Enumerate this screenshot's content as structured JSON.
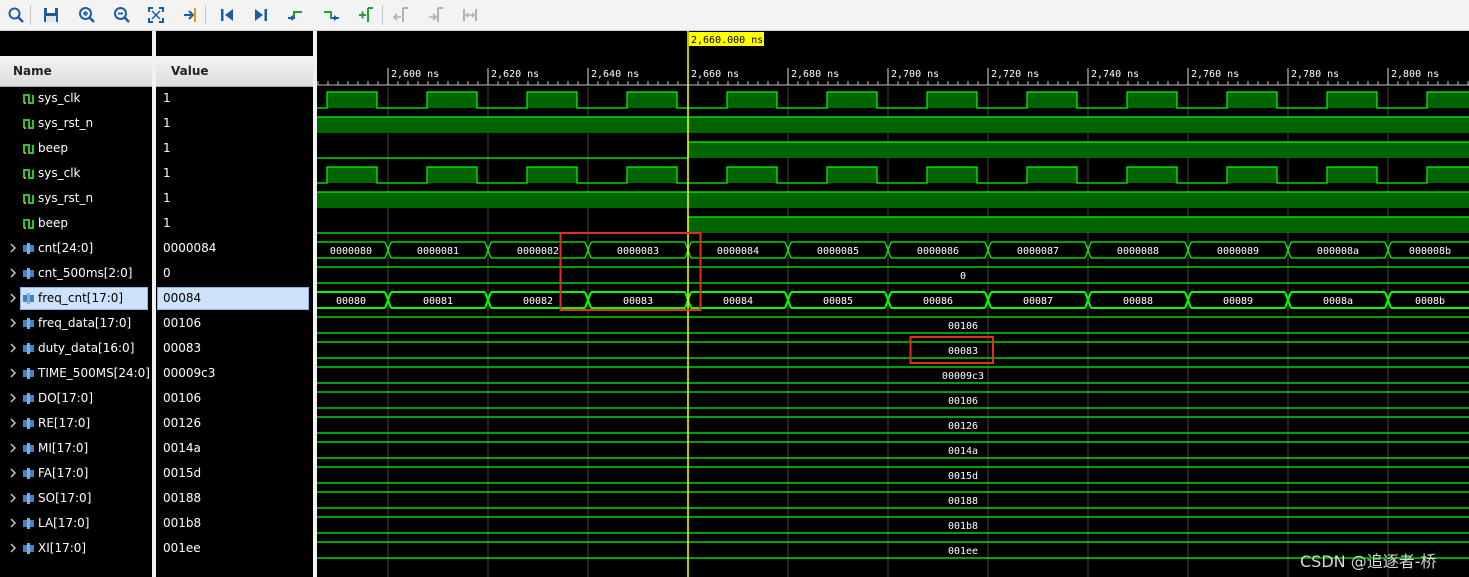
{
  "toolbar": {
    "buttons": [
      {
        "icon": "search-icon"
      },
      {
        "icon": "save-icon"
      },
      {
        "icon": "zoom-in-icon"
      },
      {
        "icon": "zoom-out-icon"
      },
      {
        "icon": "zoom-fit-icon"
      },
      {
        "icon": "go-to-cursor-icon"
      },
      {
        "icon": "go-to-start-icon"
      },
      {
        "icon": "go-to-end-icon"
      },
      {
        "icon": "previous-transition-icon"
      },
      {
        "icon": "next-transition-icon"
      },
      {
        "icon": "add-marker-icon"
      },
      {
        "icon": "previous-marker-icon"
      },
      {
        "icon": "next-marker-icon"
      },
      {
        "icon": "swap-cursors-icon"
      }
    ]
  },
  "columns": {
    "name": "Name",
    "value": "Value"
  },
  "cursor": {
    "label": "2,660.000 ns",
    "time_ns": 2660
  },
  "timeline": {
    "tick_labels": [
      "2,600 ns",
      "2,620 ns",
      "2,640 ns",
      "2,660 ns",
      "2,680 ns",
      "2,700 ns",
      "2,720 ns",
      "2,740 ns",
      "2,760 ns",
      "2,780 ns",
      "2,800 ns"
    ],
    "tick_times_ns": [
      2600,
      2620,
      2640,
      2660,
      2680,
      2700,
      2720,
      2740,
      2760,
      2780,
      2800
    ],
    "start_ns": 2585.8,
    "end_ns": 2816.2
  },
  "signals": [
    {
      "name": "sys_clk",
      "value": "1",
      "kind": "clk",
      "expandable": false,
      "icon": "green-signal-icon"
    },
    {
      "name": "sys_rst_n",
      "value": "1",
      "kind": "high",
      "expandable": false,
      "icon": "green-signal-icon"
    },
    {
      "name": "beep",
      "value": "1",
      "kind": "beep",
      "expandable": false,
      "icon": "green-signal-icon"
    },
    {
      "name": "sys_clk",
      "value": "1",
      "kind": "clk",
      "expandable": false,
      "icon": "green-signal-icon"
    },
    {
      "name": "sys_rst_n",
      "value": "1",
      "kind": "high",
      "expandable": false,
      "icon": "green-signal-icon"
    },
    {
      "name": "beep",
      "value": "1",
      "kind": "beep",
      "expandable": false,
      "icon": "green-signal-icon"
    },
    {
      "name": "cnt[24:0]",
      "value": "0000084",
      "kind": "bus",
      "expandable": true,
      "icon": "bus-signal-icon",
      "segments": [
        "0000080",
        "0000081",
        "0000082",
        "0000083",
        "0000084",
        "0000085",
        "0000086",
        "0000087",
        "0000088",
        "0000089",
        "000008a",
        "000008b"
      ]
    },
    {
      "name": "cnt_500ms[2:0]",
      "value": "0",
      "kind": "const",
      "expandable": true,
      "icon": "bus-signal-icon",
      "const": "0"
    },
    {
      "name": "freq_cnt[17:0]",
      "value": "00084",
      "kind": "bus-hl",
      "expandable": true,
      "icon": "bus-signal-icon",
      "selected": true,
      "segments": [
        "00080",
        "00081",
        "00082",
        "00083",
        "00084",
        "00085",
        "00086",
        "00087",
        "00088",
        "00089",
        "0008a",
        "0008b"
      ]
    },
    {
      "name": "freq_data[17:0]",
      "value": "00106",
      "kind": "const",
      "expandable": true,
      "icon": "bus-signal-icon",
      "const": "00106"
    },
    {
      "name": "duty_data[16:0]",
      "value": "00083",
      "kind": "const",
      "expandable": true,
      "icon": "bus-signal-icon",
      "const": "00083"
    },
    {
      "name": "TIME_500MS[24:0]",
      "value": "00009c3",
      "kind": "const",
      "expandable": true,
      "icon": "bus-signal-icon",
      "const": "00009c3"
    },
    {
      "name": "DO[17:0]",
      "value": "00106",
      "kind": "const",
      "expandable": true,
      "icon": "bus-signal-icon",
      "const": "00106"
    },
    {
      "name": "RE[17:0]",
      "value": "00126",
      "kind": "const",
      "expandable": true,
      "icon": "bus-signal-icon",
      "const": "00126"
    },
    {
      "name": "MI[17:0]",
      "value": "0014a",
      "kind": "const",
      "expandable": true,
      "icon": "bus-signal-icon",
      "const": "0014a"
    },
    {
      "name": "FA[17:0]",
      "value": "0015d",
      "kind": "const",
      "expandable": true,
      "icon": "bus-signal-icon",
      "const": "0015d"
    },
    {
      "name": "SO[17:0]",
      "value": "00188",
      "kind": "const",
      "expandable": true,
      "icon": "bus-signal-icon",
      "const": "00188"
    },
    {
      "name": "LA[17:0]",
      "value": "001b8",
      "kind": "const",
      "expandable": true,
      "icon": "bus-signal-icon",
      "const": "001b8"
    },
    {
      "name": "XI[17:0]",
      "value": "001ee",
      "kind": "const",
      "expandable": true,
      "icon": "bus-signal-icon",
      "const": "001ee"
    }
  ],
  "clock": {
    "rise_ns": [
      2587.8,
      2607.8,
      2627.8,
      2647.8,
      2667.8,
      2687.8,
      2707.8,
      2727.8,
      2747.8,
      2767.8,
      2787.8,
      2807.8
    ],
    "period_ns": 20,
    "high_ns": 10
  },
  "beep_rise_ns": 2660,
  "bus_change_ns": [
    2600,
    2620,
    2640,
    2660,
    2680,
    2700,
    2720,
    2740,
    2760,
    2780,
    2800
  ],
  "watermark": "CSDN @追逐者-桥",
  "colors": {
    "wave_green": "#00ff00",
    "fill_green": "#006400",
    "cursor": "#ffff00",
    "annotation": "#e03020"
  }
}
